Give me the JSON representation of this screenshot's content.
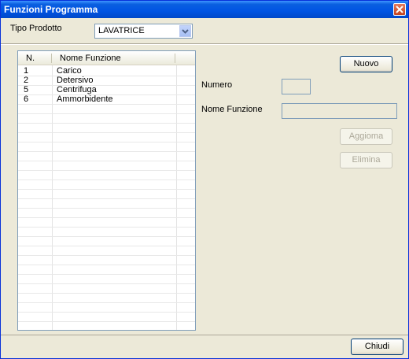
{
  "window": {
    "title": "Funzioni Programma"
  },
  "product": {
    "label": "Tipo Prodotto",
    "value": "LAVATRICE"
  },
  "list": {
    "columns": [
      "N.",
      "Nome Funzione"
    ],
    "rows": [
      {
        "num": "1",
        "name": "Carico"
      },
      {
        "num": "2",
        "name": "Detersivo"
      },
      {
        "num": "5",
        "name": "Centrifuga"
      },
      {
        "num": "6",
        "name": "Ammorbidente"
      }
    ]
  },
  "form": {
    "new_label": "Nuovo",
    "numero_label": "Numero",
    "numero_value": "",
    "nome_label": "Nome Funzione",
    "nome_value": "",
    "update_label": "Aggioma",
    "delete_label": "Elimina"
  },
  "footer": {
    "close_label": "Chiudi"
  }
}
